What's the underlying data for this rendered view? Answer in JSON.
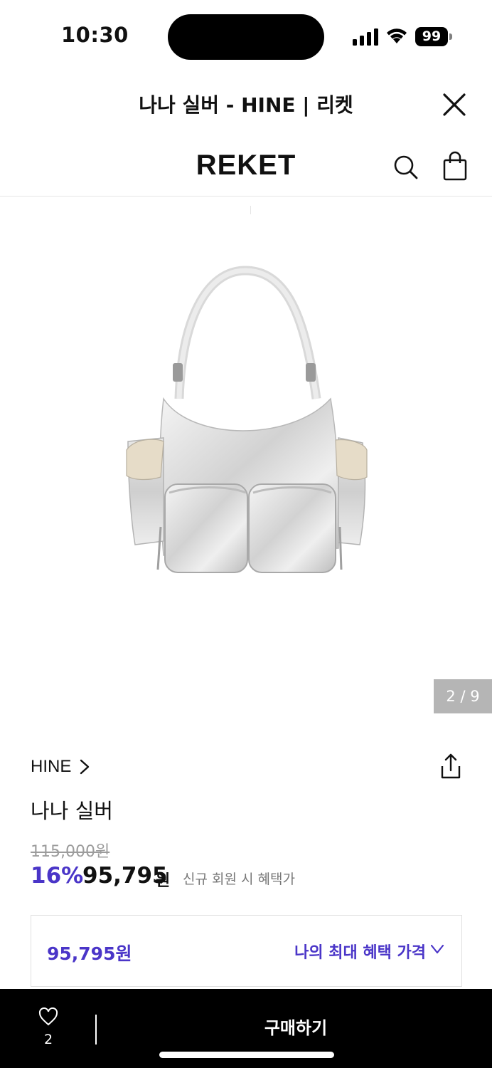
{
  "status_bar": {
    "time": "10:30",
    "battery": "99",
    "icons": [
      "signal-icon",
      "wifi-icon",
      "battery-icon"
    ]
  },
  "webview": {
    "title": "나나 실버 - HINE | 리켓",
    "close_icon": "close-icon"
  },
  "header": {
    "logo": "REKET",
    "search_icon": "search-icon",
    "cart_icon": "shopping-bag-icon"
  },
  "gallery": {
    "pager": "2 / 9",
    "current": 2,
    "total": 9
  },
  "product": {
    "brand": "HINE",
    "name": "나나 실버",
    "original_price": "115,000원",
    "discount_rate": "16%",
    "sale_price": "95,795",
    "sale_unit": "원",
    "member_note": "신규 회원 시 혜택가"
  },
  "benefit": {
    "price": "95,795원",
    "label": "나의 최대 혜택 가격"
  },
  "bottom_bar": {
    "like_count": "2",
    "buy_label": "구매하기"
  },
  "colors": {
    "accent": "#4a35c8",
    "strike": "#9c9c9c",
    "pager_bg": "#b5b5b5",
    "bar_bg": "#000000"
  }
}
